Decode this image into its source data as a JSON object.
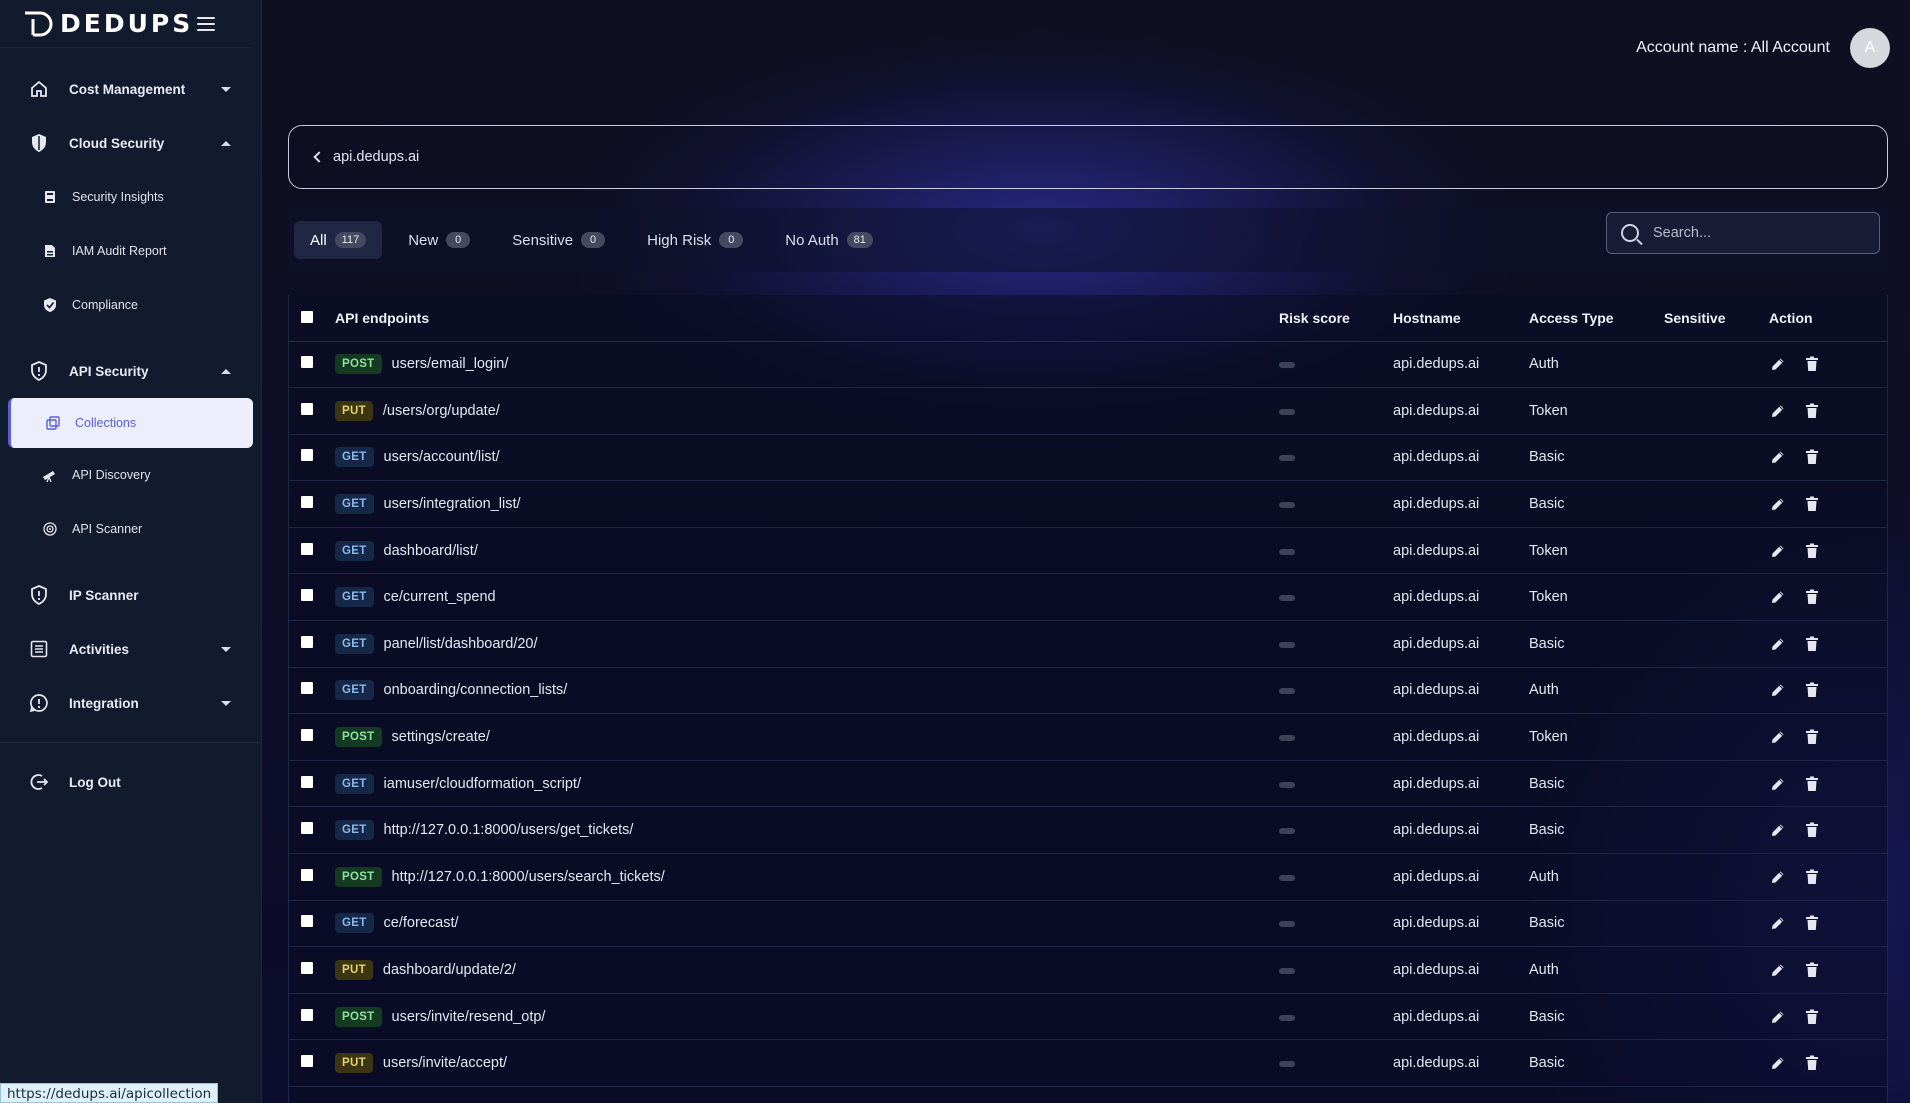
{
  "app": {
    "brand": "DEDUPS",
    "status_url": "https://dedups.ai/apicollection"
  },
  "sidebar": {
    "items": [
      {
        "label": "Cost Management",
        "icon": "home-icon",
        "expanded": false
      },
      {
        "label": "Cloud Security",
        "icon": "shield-icon",
        "expanded": true,
        "children": [
          {
            "label": "Security Insights",
            "icon": "document-icon"
          },
          {
            "label": "IAM Audit Report",
            "icon": "file-icon"
          },
          {
            "label": "Compliance",
            "icon": "check-shield-icon"
          }
        ]
      },
      {
        "label": "API Security",
        "icon": "shield-outline-icon",
        "expanded": true,
        "children": [
          {
            "label": "Collections",
            "icon": "collections-icon",
            "active": true
          },
          {
            "label": "API Discovery",
            "icon": "telescope-icon"
          },
          {
            "label": "API Scanner",
            "icon": "radar-icon"
          }
        ]
      },
      {
        "label": "IP Scanner",
        "icon": "shield-outline-icon"
      },
      {
        "label": "Activities",
        "icon": "list-icon",
        "expanded": false
      },
      {
        "label": "Integration",
        "icon": "alert-circle-icon",
        "expanded": false
      },
      {
        "label": "Log Out",
        "icon": "logout-icon"
      }
    ]
  },
  "header": {
    "account_label": "Account name : All Account",
    "avatar_letter": "A"
  },
  "breadcrumb": {
    "label": "api.dedups.ai"
  },
  "filters": {
    "tabs": [
      {
        "label": "All",
        "count": "117",
        "active": true
      },
      {
        "label": "New",
        "count": "0"
      },
      {
        "label": "Sensitive",
        "count": "0"
      },
      {
        "label": "High Risk",
        "count": "0"
      },
      {
        "label": "No Auth",
        "count": "81"
      }
    ],
    "search_placeholder": "Search..."
  },
  "table": {
    "columns": [
      "API endpoints",
      "Risk score",
      "Hostname",
      "Access Type",
      "Sensitive",
      "Action"
    ],
    "rows": [
      {
        "method": "POST",
        "path": "users/email_login/",
        "host": "api.dedups.ai",
        "access": "Auth"
      },
      {
        "method": "PUT",
        "path": "/users/org/update/",
        "host": "api.dedups.ai",
        "access": "Token"
      },
      {
        "method": "GET",
        "path": "users/account/list/",
        "host": "api.dedups.ai",
        "access": "Basic"
      },
      {
        "method": "GET",
        "path": "users/integration_list/",
        "host": "api.dedups.ai",
        "access": "Basic"
      },
      {
        "method": "GET",
        "path": "dashboard/list/",
        "host": "api.dedups.ai",
        "access": "Token"
      },
      {
        "method": "GET",
        "path": "ce/current_spend",
        "host": "api.dedups.ai",
        "access": "Token"
      },
      {
        "method": "GET",
        "path": "panel/list/dashboard/20/",
        "host": "api.dedups.ai",
        "access": "Basic"
      },
      {
        "method": "GET",
        "path": "onboarding/connection_lists/",
        "host": "api.dedups.ai",
        "access": "Auth"
      },
      {
        "method": "POST",
        "path": "settings/create/",
        "host": "api.dedups.ai",
        "access": "Token"
      },
      {
        "method": "GET",
        "path": "iamuser/cloudformation_script/",
        "host": "api.dedups.ai",
        "access": "Basic"
      },
      {
        "method": "GET",
        "path": "http://127.0.0.1:8000/users/get_tickets/",
        "host": "api.dedups.ai",
        "access": "Basic"
      },
      {
        "method": "POST",
        "path": "http://127.0.0.1:8000/users/search_tickets/",
        "host": "api.dedups.ai",
        "access": "Auth"
      },
      {
        "method": "GET",
        "path": "ce/forecast/",
        "host": "api.dedups.ai",
        "access": "Basic"
      },
      {
        "method": "PUT",
        "path": "dashboard/update/2/",
        "host": "api.dedups.ai",
        "access": "Auth"
      },
      {
        "method": "POST",
        "path": "users/invite/resend_otp/",
        "host": "api.dedups.ai",
        "access": "Basic"
      },
      {
        "method": "PUT",
        "path": "users/invite/accept/",
        "host": "api.dedups.ai",
        "access": "Basic"
      }
    ]
  },
  "colors": {
    "accent": "#5a5fd6",
    "post": "#8fe0a0",
    "put": "#e3d26e",
    "get": "#8ab8ec"
  }
}
